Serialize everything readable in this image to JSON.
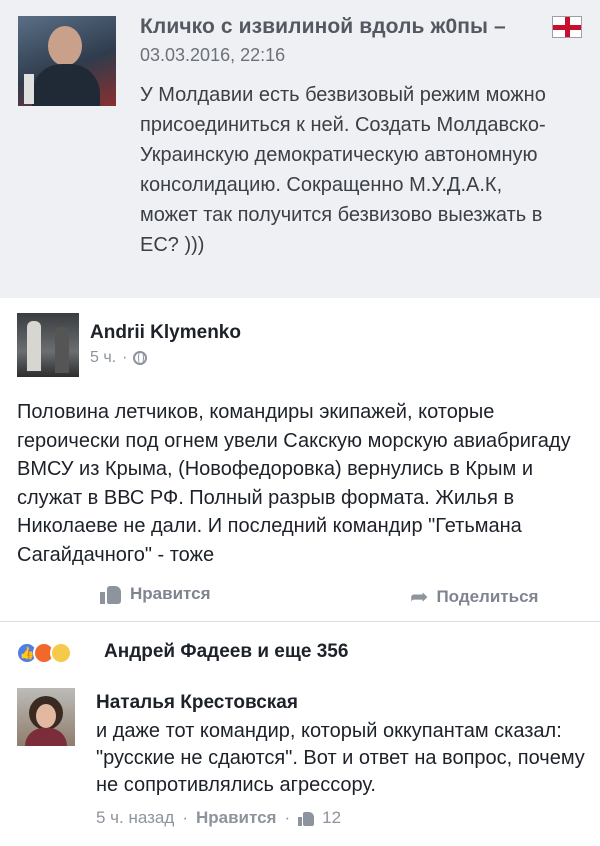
{
  "quote": {
    "title": "Кличко с извилиной вдоль ж0пы –",
    "timestamp": "03.03.2016, 22:16",
    "text": "У Молдавии есть безвизовый режим можно присоединиться к ней. Создать Молдавско-Украинскую демократическую автономную консолидацию. Сокращенно М.У.Д.А.К, может так получится безвизово выезжать в ЕС? )))",
    "flag_icon": "uk-flag-icon"
  },
  "post": {
    "author": "Andrii Klymenko",
    "time": "5 ч.",
    "separator": "·",
    "privacy_icon": "globe-icon",
    "text": "Половина летчиков, командиры экипажей, которые героически под огнем увели Сакскую морскую авиабригаду ВМСУ из Крыма, (Новофедоровка) вернулись в Крым и служат в ВВС РФ. Полный разрыв формата. Жилья в Николаеве не дали. И последний командир \"Гетьмана Сагайдачного\" - тоже"
  },
  "actions": {
    "like_label": "Нравится",
    "share_label": "Поделиться"
  },
  "reactions": {
    "icons": [
      "like",
      "angry",
      "sad"
    ],
    "summary": "Андрей Фадеев и еще 356"
  },
  "comment": {
    "author": "Наталья Крестовская",
    "text": "и даже тот командир, который оккупантам сказал: \"русские не сдаются\". Вот и ответ на вопрос, почему не сопротивлялись агрессору.",
    "time": "5 ч. назад",
    "like_label": "Нравится",
    "like_count": "12",
    "dot": "·"
  }
}
